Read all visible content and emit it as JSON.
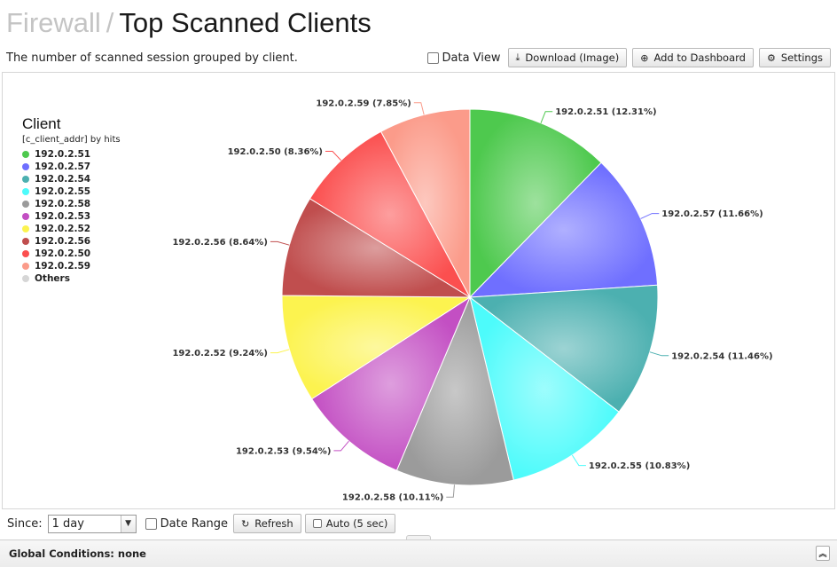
{
  "header": {
    "crumb": "Firewall",
    "separator": "/",
    "title": "Top Scanned Clients",
    "subtitle": "The number of scanned session grouped by client."
  },
  "toolbar": {
    "data_view_label": "Data View",
    "download_label": "Download (Image)",
    "add_dashboard_label": "Add to Dashboard",
    "settings_label": "Settings"
  },
  "legend": {
    "title": "Client",
    "subtitle": "[c_client_addr] by hits"
  },
  "chart_data": {
    "type": "pie",
    "title": "Client",
    "subtitle": "[c_client_addr] by hits",
    "categories": [
      "192.0.2.51",
      "192.0.2.57",
      "192.0.2.54",
      "192.0.2.55",
      "192.0.2.58",
      "192.0.2.53",
      "192.0.2.52",
      "192.0.2.56",
      "192.0.2.50",
      "192.0.2.59",
      "Others"
    ],
    "values": [
      12.31,
      11.66,
      11.46,
      10.83,
      10.11,
      9.54,
      9.24,
      8.64,
      8.36,
      7.85,
      0
    ],
    "labels": [
      "192.0.2.51 (12.31%)",
      "192.0.2.57 (11.66%)",
      "192.0.2.54 (11.46%)",
      "192.0.2.55 (10.83%)",
      "192.0.2.58 (10.11%)",
      "192.0.2.53 (9.54%)",
      "192.0.2.52 (9.24%)",
      "192.0.2.56 (8.64%)",
      "192.0.2.50 (8.36%)",
      "192.0.2.59 (7.85%)",
      ""
    ],
    "colors": [
      "#4ec94e",
      "#6f6fff",
      "#4cb0b0",
      "#4dfbfb",
      "#9b9b9b",
      "#c34fc3",
      "#fcf34f",
      "#c04e4e",
      "#fb4f4f",
      "#fb9b8a",
      "#d6d6d6"
    ],
    "legend_position": "left"
  },
  "bottom": {
    "since_label": "Since:",
    "since_value": "1 day",
    "date_range_label": "Date Range",
    "refresh_label": "Refresh",
    "auto_label": "Auto (5 sec)"
  },
  "global": {
    "label": "Global Conditions: none"
  }
}
